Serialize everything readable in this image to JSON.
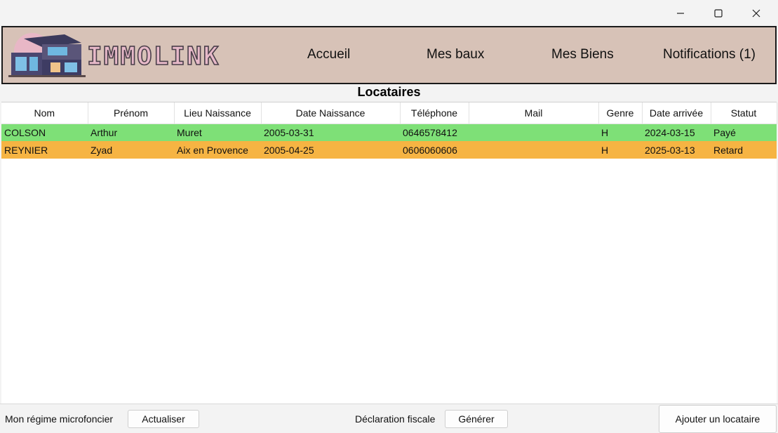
{
  "window": {
    "controls": [
      "minimize-icon",
      "maximize-icon",
      "close-icon"
    ]
  },
  "nav": {
    "logo_text": "IMMOLINK",
    "items": [
      {
        "label": "Accueil"
      },
      {
        "label": "Mes baux"
      },
      {
        "label": "Mes Biens"
      },
      {
        "label": "Notifications (1)"
      }
    ]
  },
  "page_title": "Locataires",
  "table": {
    "columns": [
      "Nom",
      "Prénom",
      "Lieu Naissance",
      "Date Naissance",
      "Téléphone",
      "Mail",
      "Genre",
      "Date arrivée",
      "Statut"
    ],
    "rows": [
      {
        "nom": "COLSON",
        "prenom": "Arthur",
        "lieu": "Muret",
        "date_naissance": "2005-03-31",
        "telephone": "0646578412",
        "mail": "",
        "genre": "H",
        "date_arrivee": "2024-03-15",
        "statut": "Payé",
        "color": "#7ee077"
      },
      {
        "nom": "REYNIER",
        "prenom": "Zyad",
        "lieu": "Aix en Provence",
        "date_naissance": "2005-04-25",
        "telephone": "0606060606",
        "mail": "",
        "genre": "H",
        "date_arrivee": "2025-03-13",
        "statut": "Retard",
        "color": "#f6b443"
      }
    ]
  },
  "bottom": {
    "regime_label": "Mon régime microfoncier",
    "actualiser": "Actualiser",
    "declaration_label": "Déclaration fiscale",
    "generer": "Générer",
    "ajouter": "Ajouter un locataire"
  },
  "colors": {
    "nav_bg": "#d7c2b7",
    "logo_text": "#e7b9c9",
    "row_paid": "#7ee077",
    "row_late": "#f6b443"
  }
}
